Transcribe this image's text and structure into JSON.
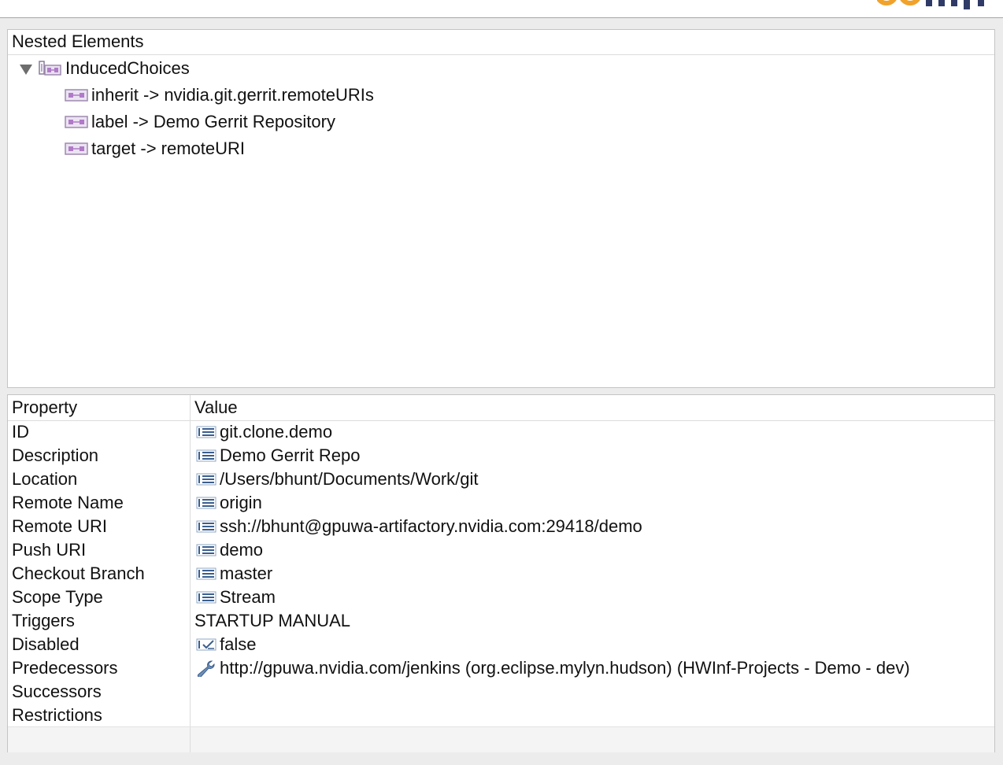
{
  "nested_panel": {
    "title": "Nested Elements",
    "root": {
      "label": "InducedChoices",
      "expanded": true,
      "children": [
        {
          "label": "inherit -> nvidia.git.gerrit.remoteURIs"
        },
        {
          "label": "label -> Demo Gerrit Repository"
        },
        {
          "label": "target -> remoteURI"
        }
      ]
    }
  },
  "properties_panel": {
    "columns": {
      "property": "Property",
      "value": "Value"
    },
    "rows": [
      {
        "property": "ID",
        "value": "git.clone.demo",
        "icon": "text-field-icon"
      },
      {
        "property": "Description",
        "value": "Demo Gerrit Repo",
        "icon": "text-field-icon"
      },
      {
        "property": "Location",
        "value": "/Users/bhunt/Documents/Work/git",
        "icon": "text-field-icon"
      },
      {
        "property": "Remote Name",
        "value": "origin",
        "icon": "text-field-icon"
      },
      {
        "property": "Remote URI",
        "value": "ssh://bhunt@gpuwa-artifactory.nvidia.com:29418/demo",
        "icon": "text-field-icon"
      },
      {
        "property": "Push URI",
        "value": "demo",
        "icon": "text-field-icon"
      },
      {
        "property": "Checkout Branch",
        "value": "master",
        "icon": "text-field-icon"
      },
      {
        "property": "Scope Type",
        "value": "Stream",
        "icon": "text-field-icon"
      },
      {
        "property": "Triggers",
        "value": "STARTUP MANUAL",
        "icon": ""
      },
      {
        "property": "Disabled",
        "value": "false",
        "icon": "boolean-check-icon"
      },
      {
        "property": "Predecessors",
        "value": "http://gpuwa.nvidia.com/jenkins (org.eclipse.mylyn.hudson) (HWInf-Projects - Demo - dev)",
        "icon": "wrench-icon"
      },
      {
        "property": "Successors",
        "value": "",
        "icon": ""
      },
      {
        "property": "Restrictions",
        "value": "",
        "icon": ""
      }
    ]
  },
  "colors": {
    "panel_bg": "#ffffff",
    "window_bg": "#ececec",
    "logo_accent": "#f0a22a"
  }
}
